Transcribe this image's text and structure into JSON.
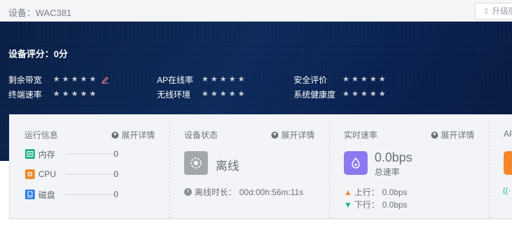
{
  "header": {
    "device_title": "设备：WAC381",
    "upgrade_label": "升级版本"
  },
  "hero": {
    "score_text": "设备评分：0分",
    "ratings": [
      {
        "label": "剩余带宽",
        "stars": 0
      },
      {
        "label": "AP在线率",
        "stars": 0
      },
      {
        "label": "安全评价",
        "stars": 0
      },
      {
        "label": "终端速率",
        "stars": 0
      },
      {
        "label": "无线环境",
        "stars": 0
      },
      {
        "label": "系统健康度",
        "stars": 0
      }
    ]
  },
  "run_info": {
    "title": "运行信息",
    "expand_label": "展开详情",
    "resources": [
      {
        "label": "内存",
        "value": "0",
        "color": "#1fb08c"
      },
      {
        "label": "CPU",
        "value": "0",
        "color": "#f08a2c"
      },
      {
        "label": "磁盘",
        "value": "0",
        "color": "#2f7fe8"
      }
    ]
  },
  "device_status": {
    "title": "设备状态",
    "expand_label": "展开详情",
    "status": "离线",
    "offline_duration_label": "离线时长：",
    "offline_duration": "00d:00h:56m:11s"
  },
  "realtime_rate": {
    "title": "实时速率",
    "expand_label": "展开详情",
    "total_rate": "0.0bps",
    "total_label": "总速率",
    "up_label": "上行：",
    "up_value": "0.0bps",
    "down_label": "下行：",
    "down_value": "0.0bps"
  },
  "ap_section": {
    "title": "AP"
  }
}
